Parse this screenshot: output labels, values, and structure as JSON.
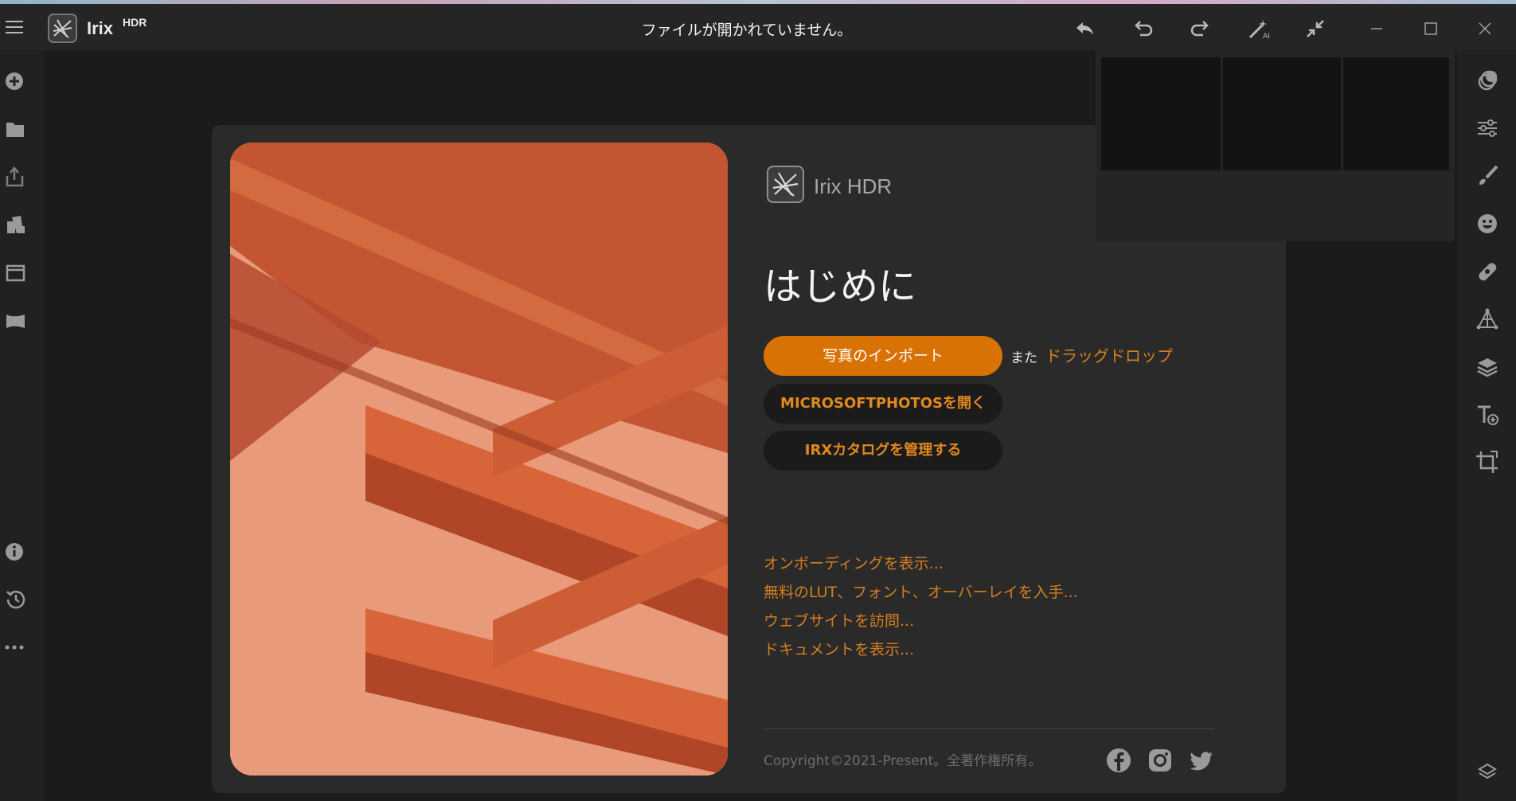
{
  "titlebar": {
    "app_name": "Irix",
    "app_name_sup": "HDR",
    "document_status": "ファイルが開かれていません。"
  },
  "welcome": {
    "brand_name": "Irix HDR",
    "heading": "はじめに",
    "import_button": "写真のインポート",
    "or_text": "また",
    "drag_drop_link": "ドラッグドロップ",
    "open_microsoft_photos_button": "MICROSOFTPHOTOSを開く",
    "manage_catalog_button": "IRXカタログを管理する",
    "links": [
      "オンボーディングを表示...",
      "無料のLUT、フォント、オーバーレイを入手...",
      "ウェブサイトを訪問...",
      "ドキュメントを表示..."
    ],
    "copyright": "Copyright©2021-Present。全著作権所有。"
  },
  "colors": {
    "accent": "#d97204",
    "link": "#d67e1f",
    "background": "#1b1b1b",
    "panel": "#2a2a2a",
    "photo": "#e59270"
  },
  "icons": {
    "left_rail": [
      "add-icon",
      "folder-icon",
      "export-icon",
      "batch-icon",
      "window-icon",
      "panorama-icon",
      "info-icon",
      "history-icon",
      "more-icon"
    ],
    "right_rail": [
      "presets-icon",
      "adjustments-icon",
      "brush-icon",
      "face-icon",
      "healing-icon",
      "geometry-icon",
      "layers-icon",
      "text-add-icon",
      "crop-icon",
      "expand-icon"
    ],
    "titlebar": [
      "back-icon",
      "undo-icon",
      "redo-icon",
      "ai-magic-icon",
      "compress-icon",
      "minimize-icon",
      "maximize-icon",
      "close-icon"
    ],
    "social": [
      "facebook-icon",
      "instagram-icon",
      "twitter-icon"
    ]
  }
}
